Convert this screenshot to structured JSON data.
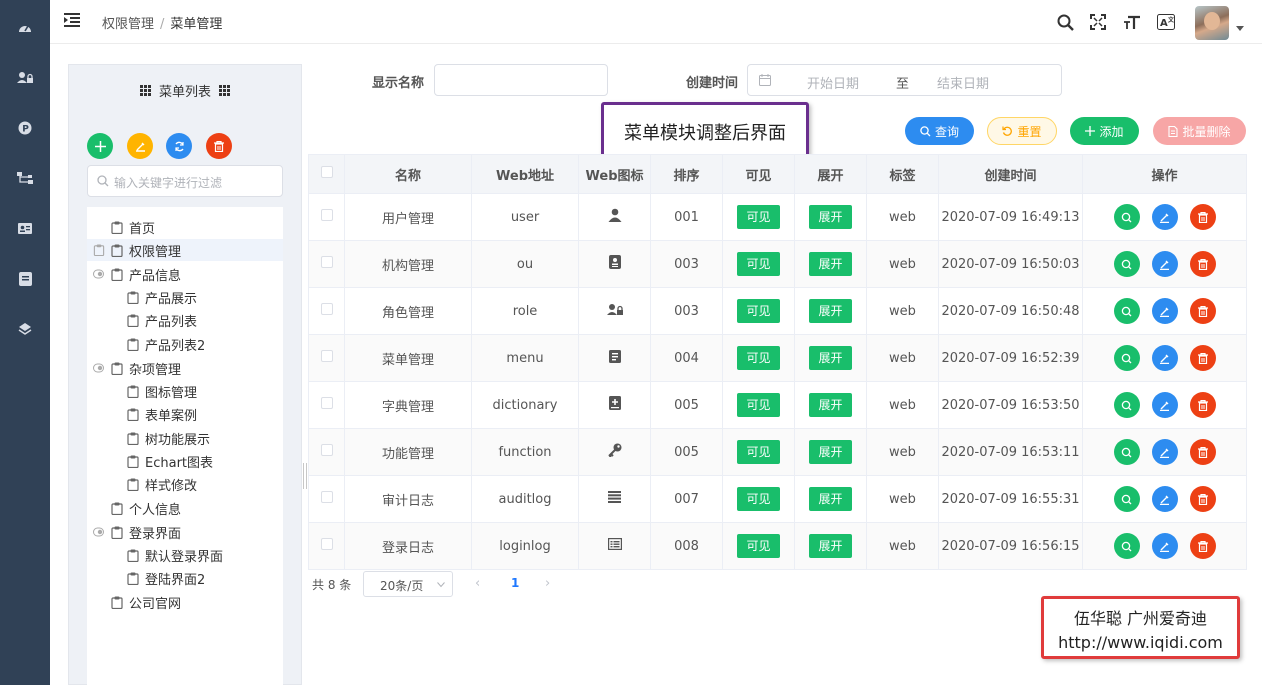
{
  "header": {
    "breadcrumb": [
      "权限管理",
      "菜单管理"
    ]
  },
  "rail_icons": [
    "dashboard-icon",
    "user-lock-icon",
    "p-icon",
    "sitemap-icon",
    "id-card-icon",
    "book-icon",
    "layers-icon"
  ],
  "tree": {
    "title": "菜单列表",
    "search_placeholder": "输入关键字进行过滤",
    "nodes": [
      {
        "label": "首页"
      },
      {
        "label": "权限管理"
      },
      {
        "label": "产品信息"
      },
      {
        "label": "产品展示"
      },
      {
        "label": "产品列表"
      },
      {
        "label": "产品列表2"
      },
      {
        "label": "杂项管理"
      },
      {
        "label": "图标管理"
      },
      {
        "label": "表单案例"
      },
      {
        "label": "树功能展示"
      },
      {
        "label": "Echart图表"
      },
      {
        "label": "样式修改"
      },
      {
        "label": "个人信息"
      },
      {
        "label": "登录界面"
      },
      {
        "label": "默认登录界面"
      },
      {
        "label": "登陆界面2"
      },
      {
        "label": "公司官网"
      }
    ]
  },
  "filter": {
    "name_label": "显示名称",
    "name_value": "",
    "date_label": "创建时间",
    "start_placeholder": "开始日期",
    "range_sep": "至",
    "end_placeholder": "结束日期"
  },
  "callout": "菜单模块调整后界面",
  "buttons": {
    "query": "查询",
    "reset": "重置",
    "add": "添加",
    "batch_delete": "批量删除"
  },
  "table": {
    "columns": [
      "名称",
      "Web地址",
      "Web图标",
      "排序",
      "可见",
      "展开",
      "标签",
      "创建时间",
      "操作"
    ],
    "rows": [
      {
        "name": "用户管理",
        "url": "user",
        "icon": "user-icon",
        "sort": "001",
        "visible": "可见",
        "expand": "展开",
        "tag": "web",
        "created": "2020-07-09 16:49:13"
      },
      {
        "name": "机构管理",
        "url": "ou",
        "icon": "ou-icon",
        "sort": "003",
        "visible": "可见",
        "expand": "展开",
        "tag": "web",
        "created": "2020-07-09 16:50:03"
      },
      {
        "name": "角色管理",
        "url": "role",
        "icon": "role-icon",
        "sort": "003",
        "visible": "可见",
        "expand": "展开",
        "tag": "web",
        "created": "2020-07-09 16:50:48"
      },
      {
        "name": "菜单管理",
        "url": "menu",
        "icon": "menu-icon",
        "sort": "004",
        "visible": "可见",
        "expand": "展开",
        "tag": "web",
        "created": "2020-07-09 16:52:39"
      },
      {
        "name": "字典管理",
        "url": "dictionary",
        "icon": "dictionary-icon",
        "sort": "005",
        "visible": "可见",
        "expand": "展开",
        "tag": "web",
        "created": "2020-07-09 16:53:50"
      },
      {
        "name": "功能管理",
        "url": "function",
        "icon": "key-icon",
        "sort": "005",
        "visible": "可见",
        "expand": "展开",
        "tag": "web",
        "created": "2020-07-09 16:53:11"
      },
      {
        "name": "审计日志",
        "url": "auditlog",
        "icon": "list-icon",
        "sort": "007",
        "visible": "可见",
        "expand": "展开",
        "tag": "web",
        "created": "2020-07-09 16:55:31"
      },
      {
        "name": "登录日志",
        "url": "loginlog",
        "icon": "list-alt-icon",
        "sort": "008",
        "visible": "可见",
        "expand": "展开",
        "tag": "web",
        "created": "2020-07-09 16:56:15"
      }
    ]
  },
  "pagination": {
    "total": "共 8 条",
    "page_size": "20条/页",
    "current": "1"
  },
  "watermark": {
    "line1": "伍华聪 广州爱奇迪",
    "line2": "http://www.iqidi.com"
  },
  "colors": {
    "rail": "#304156",
    "green": "#19be6b",
    "blue": "#2d8cf0",
    "red": "#ed4014",
    "yellow": "#ff9900"
  }
}
